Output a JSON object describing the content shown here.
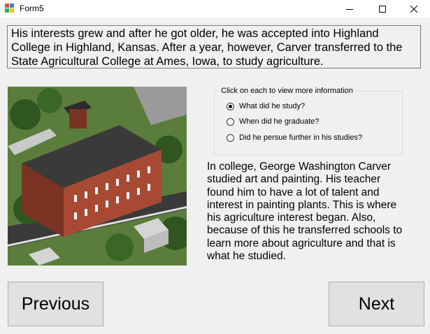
{
  "window": {
    "title": "Form5"
  },
  "banner": {
    "text": "His interests grew and after he got older, he was accepted into Highland College in Highland, Kansas. After a year, however, Carver transferred to the State Agricultural College at Ames, Iowa, to study agriculture."
  },
  "options_group": {
    "legend": "Click on each to view more information",
    "options": [
      {
        "label": "What did he study?",
        "checked": true
      },
      {
        "label": "When did he graduate?",
        "checked": false
      },
      {
        "label": "Did he persue further in his studies?",
        "checked": false
      }
    ]
  },
  "info": {
    "text": "In college, George Washington Carver studied art and painting. His teacher found him to have a lot of talent and interest in painting plants. This is where his agriculture interest began. Also, because of this he transferred schools to learn more about agriculture and that is what he studied."
  },
  "buttons": {
    "previous": "Previous",
    "next": "Next"
  }
}
